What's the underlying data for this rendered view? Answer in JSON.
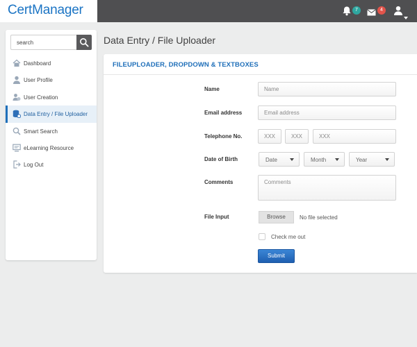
{
  "app": {
    "brand": "CertManager",
    "colors": {
      "brand": "#1b74c4",
      "topbar": "#4f4f51",
      "accent": "#1e6fba",
      "badge_notifications": "#2fa7a0",
      "badge_messages": "#e2544b"
    }
  },
  "topbar": {
    "notifications_icon": "bell-icon",
    "notifications_count": "7",
    "messages_icon": "envelope-icon",
    "messages_count": "4",
    "user_icon": "user-icon",
    "user_menu_icon": "caret-down-icon"
  },
  "sidebar": {
    "search_placeholder": "search",
    "search_icon": "search-icon",
    "items": [
      {
        "label": "Dashboard",
        "icon": "home-icon",
        "active": false
      },
      {
        "label": "User Profile",
        "icon": "user-icon",
        "active": false
      },
      {
        "label": "User Creation",
        "icon": "users-icon",
        "active": false
      },
      {
        "label": "Data Entry / File Uploader",
        "icon": "database-upload-icon",
        "active": true
      },
      {
        "label": "Smart Search",
        "icon": "search-icon",
        "active": false
      },
      {
        "label": "eLearning Resource",
        "icon": "monitor-icon",
        "active": false
      },
      {
        "label": "Log Out",
        "icon": "logout-icon",
        "active": false
      }
    ]
  },
  "main": {
    "page_title": "Data Entry / File Uploader",
    "panel_title": "FILEUPLOADER, DROPDOWN & TEXTBOXES",
    "form": {
      "name_label": "Name",
      "name_placeholder": "Name",
      "email_label": "Email address",
      "email_placeholder": "Email address",
      "phone_label": "Telephone No.",
      "phone_placeholders": [
        "XXX",
        "XXX",
        "XXX"
      ],
      "dob_label": "Date of Birth",
      "dob_selects": [
        "Date",
        "Month",
        "Year"
      ],
      "comments_label": "Comments",
      "comments_placeholder": "Comments",
      "file_label": "File Input",
      "browse_label": "Browse",
      "file_status": "No file selected",
      "checkbox_label": "Check me out",
      "submit_label": "Submit"
    }
  }
}
